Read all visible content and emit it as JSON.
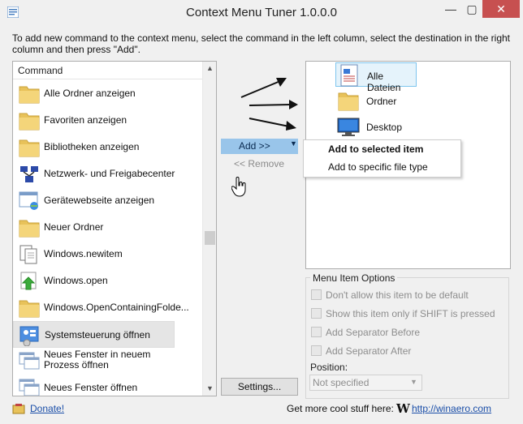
{
  "window": {
    "title": "Context Menu Tuner 1.0.0.0",
    "minimize": "—",
    "maximize": "▢",
    "close": "✕"
  },
  "instructions": "To add new command to the context menu, select the command in the left column, select the destination in the right column and then press \"Add\".",
  "commands": {
    "header": "Command",
    "items": [
      {
        "label": "Alle Ordner anzeigen",
        "icon": "folder-icon"
      },
      {
        "label": "Favoriten anzeigen",
        "icon": "folder-icon"
      },
      {
        "label": "Bibliotheken anzeigen",
        "icon": "folder-icon"
      },
      {
        "label": "Netzwerk- und Freigabecenter",
        "icon": "network-icon"
      },
      {
        "label": "Gerätewebseite anzeigen",
        "icon": "webpage-icon"
      },
      {
        "label": "Neuer Ordner",
        "icon": "folder-icon"
      },
      {
        "label": "Windows.newitem",
        "icon": "document-icon"
      },
      {
        "label": "Windows.open",
        "icon": "open-arrow-icon"
      },
      {
        "label": "Windows.OpenContainingFolde...",
        "icon": "folder-icon"
      },
      {
        "label": "Systemsteuerung öffnen",
        "icon": "control-panel-icon"
      },
      {
        "label": "Neues Fenster in neuem Prozess öffnen",
        "icon": "window-icon"
      },
      {
        "label": "Neues Fenster öffnen",
        "icon": "window-icon"
      }
    ]
  },
  "actions": {
    "add": "Add >>",
    "add_caret": "▼",
    "remove": "<< Remove",
    "settings": "Settings..."
  },
  "destinations": [
    {
      "label": "Alle Dateien",
      "icon": "all-files-icon",
      "selected": true
    },
    {
      "label": "Ordner",
      "icon": "folder-icon",
      "selected": false
    },
    {
      "label": "Desktop",
      "icon": "desktop-icon",
      "selected": false
    }
  ],
  "add_menu": {
    "items": [
      "Add to selected item",
      "Add to specific file type"
    ]
  },
  "options": {
    "title": "Menu Item Options",
    "checkboxes": [
      "Don't allow this item to be default",
      "Show this item only if SHIFT is pressed",
      "Add Separator Before",
      "Add Separator After"
    ],
    "position_label": "Position:",
    "position_value": "Not specified"
  },
  "footer": {
    "donate": "Donate!",
    "promo": "Get more cool stuff here:",
    "logo": "W",
    "url": "http://winaero.com"
  },
  "colors": {
    "accent": "#99c5ea",
    "link": "#1a4ea8",
    "close": "#c75050",
    "selection": "#e5f3fb"
  }
}
